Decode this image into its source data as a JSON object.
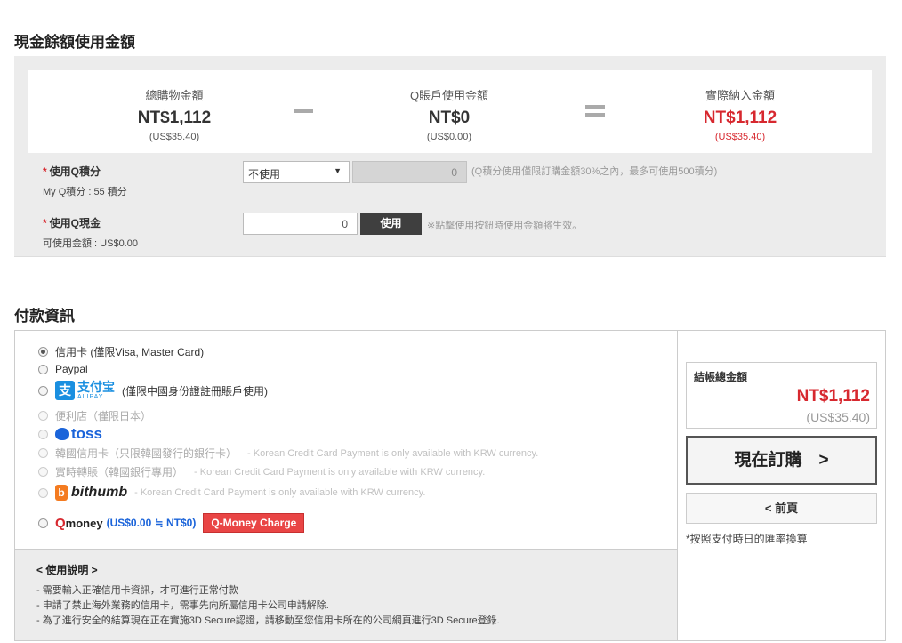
{
  "cash": {
    "title": "現金餘額使用金額",
    "total": {
      "label": "總購物金額",
      "amount": "NT$1,112",
      "usd": "(US$35.40)"
    },
    "qaccount": {
      "label": "Q賬戶使用金額",
      "amount": "NT$0",
      "usd": "(US$0.00)"
    },
    "actual": {
      "label": "實際納入金額",
      "amount": "NT$1,112",
      "usd": "(US$35.40)"
    },
    "qpoints": {
      "star": "*",
      "label": "使用Q積分",
      "sub": "My Q積分 : 55 積分",
      "select_value": "不使用",
      "select_arrow": "▼",
      "input_value": "0",
      "hint": "(Q積分使用僅限訂購金額30%之內，最多可使用500積分)"
    },
    "qcash": {
      "star": "*",
      "label": "使用Q現金",
      "sub": "可使用金額 : US$0.00",
      "input_value": "0",
      "button": "使用",
      "hint": "※點擊使用按鈕時使用金額將生效。"
    }
  },
  "payment": {
    "title": "付款資訊",
    "options": {
      "credit_card": "信用卡 (僅限Visa, Master Card)",
      "paypal": "Paypal",
      "alipay_logo_icon": "支",
      "alipay_logo_cn": "支付宝",
      "alipay_logo_en": "ALIPAY",
      "alipay_note": "(僅限中國身份證註冊賬戶使用)",
      "convenience_store": "便利店（僅限日本）",
      "toss_logo": "toss",
      "korea_card": "韓國信用卡（只限韓國發行的銀行卡）",
      "korea_card_note": "- Korean Credit Card Payment is only available with KRW currency.",
      "realtime_transfer": "實時轉賬（韓國銀行專用）",
      "realtime_transfer_note": "- Korean Credit Card Payment is only available with KRW currency.",
      "bithumb_icon": "b",
      "bithumb_logo": "bithumb",
      "bithumb_note": "- Korean Credit Card Payment is only available with KRW currency.",
      "qmoney_q": "Q",
      "qmoney_logo": "money",
      "qmoney_conv": "(US$0.00 ≒ NT$0)",
      "qmoney_charge": "Q-Money Charge"
    },
    "notes": {
      "heading": "< 使用說明 >",
      "lines": [
        "- 需要輸入正確信用卡資訊，才可進行正常付款",
        "- 申請了禁止海外業務的信用卡，需事先向所屬信用卡公司申請解除.",
        "- 為了進行安全的結算現在正在實施3D Secure認證，請移動至您信用卡所在的公司網頁進行3D Secure登錄."
      ]
    },
    "summary": {
      "total_label": "結帳總金額",
      "total_amount": "NT$1,112",
      "total_usd": "(US$35.40)",
      "order_button": "現在訂購　>",
      "prev_button": "< 前頁",
      "fx_note": "*按照支付時日的匯率換算"
    }
  },
  "colors": {
    "accent_red": "#d7282f",
    "alipay_blue": "#1a8fe0",
    "toss_blue": "#1b64da",
    "bithumb_orange": "#f47b20"
  }
}
